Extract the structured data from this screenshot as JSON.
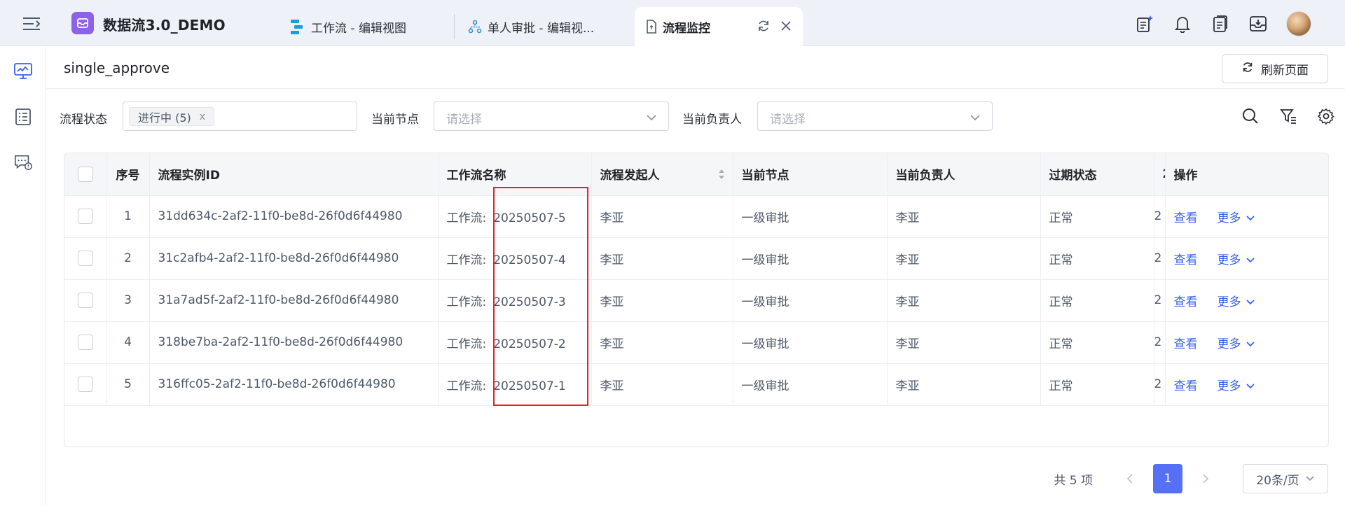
{
  "app": {
    "title": "数据流3.0_DEMO"
  },
  "tabs": [
    {
      "label": "工作流 - 编辑视图",
      "icon": "workflow-icon"
    },
    {
      "label": "单人审批 - 编辑视...",
      "icon": "org-chart-icon"
    },
    {
      "label": "流程监控",
      "icon": "document-icon",
      "active": true
    }
  ],
  "header_icons": [
    "ai-notes-icon",
    "bell-icon",
    "clipboard-icon",
    "download-tray-icon",
    "avatar"
  ],
  "sidebar": [
    "monitor-icon",
    "list-icon",
    "chat-alert-icon"
  ],
  "page": {
    "title": "single_approve",
    "refresh_label": "刷新页面"
  },
  "filters": {
    "status_label": "流程状态",
    "status_tag": "进行中 (5)",
    "status_tag_close": "x",
    "node_label": "当前节点",
    "node_placeholder": "请选择",
    "owner_label": "当前负责人",
    "owner_placeholder": "请选择"
  },
  "table": {
    "columns": [
      "序号",
      "流程实例ID",
      "工作流名称",
      "流程发起人",
      "当前节点",
      "当前负责人",
      "过期状态",
      "2",
      "操作"
    ],
    "rows": [
      {
        "no": "1",
        "id": "31dd634c-2af2-11f0-be8d-26f0d6f44980",
        "prefix": "工作流:",
        "code": "20250507-5",
        "initiator": "李亚",
        "node": "一级审批",
        "owner": "李亚",
        "expire": "正常",
        "extra": "2"
      },
      {
        "no": "2",
        "id": "31c2afb4-2af2-11f0-be8d-26f0d6f44980",
        "prefix": "工作流:",
        "code": "20250507-4",
        "initiator": "李亚",
        "node": "一级审批",
        "owner": "李亚",
        "expire": "正常",
        "extra": "2"
      },
      {
        "no": "3",
        "id": "31a7ad5f-2af2-11f0-be8d-26f0d6f44980",
        "prefix": "工作流:",
        "code": "20250507-3",
        "initiator": "李亚",
        "node": "一级审批",
        "owner": "李亚",
        "expire": "正常",
        "extra": "2"
      },
      {
        "no": "4",
        "id": "318be7ba-2af2-11f0-be8d-26f0d6f44980",
        "prefix": "工作流:",
        "code": "20250507-2",
        "initiator": "李亚",
        "node": "一级审批",
        "owner": "李亚",
        "expire": "正常",
        "extra": "2"
      },
      {
        "no": "5",
        "id": "316ffc05-2af2-11f0-be8d-26f0d6f44980",
        "prefix": "工作流:",
        "code": "20250507-1",
        "initiator": "李亚",
        "node": "一级审批",
        "owner": "李亚",
        "expire": "正常",
        "extra": "2"
      }
    ],
    "actions": {
      "view": "查看",
      "more": "更多"
    }
  },
  "pagination": {
    "total": "共 5 项",
    "current": "1",
    "page_size": "20条/页"
  },
  "colors": {
    "accent": "#5570f5",
    "link": "#3a62e8",
    "highlight": "#e0222a",
    "logo": "#8c63e6"
  }
}
